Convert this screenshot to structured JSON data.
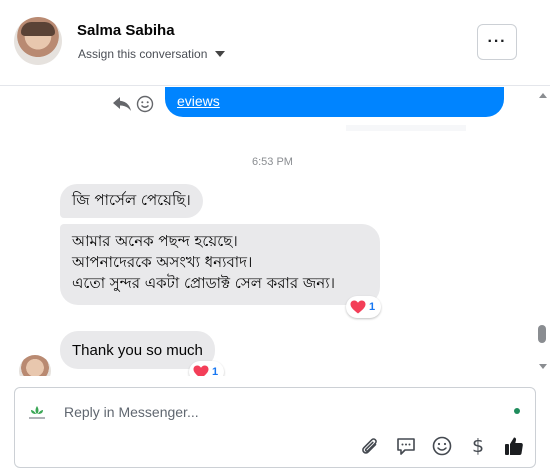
{
  "header": {
    "contact_name": "Salma Sabiha",
    "assign_label": "Assign this conversation",
    "more_label": "···"
  },
  "thread": {
    "sent_link_text": "eviews",
    "timestamp": "6:53 PM",
    "messages": [
      {
        "lines": [
          "জি পার্সেল পেয়েছি।"
        ]
      },
      {
        "lines": [
          "আমার অনেক পছন্দ হয়েছে।",
          "আপনাদেরকে অসংখ্য ধন্যবাদ।",
          "এতো সুন্দর একটা প্রোডাক্ট সেল করার জন্য।"
        ],
        "reaction_count": "1"
      },
      {
        "lines": [
          "Thank you so much"
        ],
        "reaction_count": "1"
      }
    ]
  },
  "composer": {
    "placeholder": "Reply in Messenger...",
    "dollar_label": "$"
  },
  "icons": {
    "reply": "reply-icon",
    "react": "smile-icon",
    "attach": "paperclip-icon",
    "saved_replies": "chat-bubble-icon",
    "emoji": "emoji-icon",
    "payment": "dollar-icon",
    "like": "thumbs-up-icon"
  },
  "colors": {
    "sent_bubble": "#0084ff",
    "received_bubble": "#e9e9eb",
    "reaction_heart": "#f33e58",
    "status_dot": "#1f8c5c"
  }
}
